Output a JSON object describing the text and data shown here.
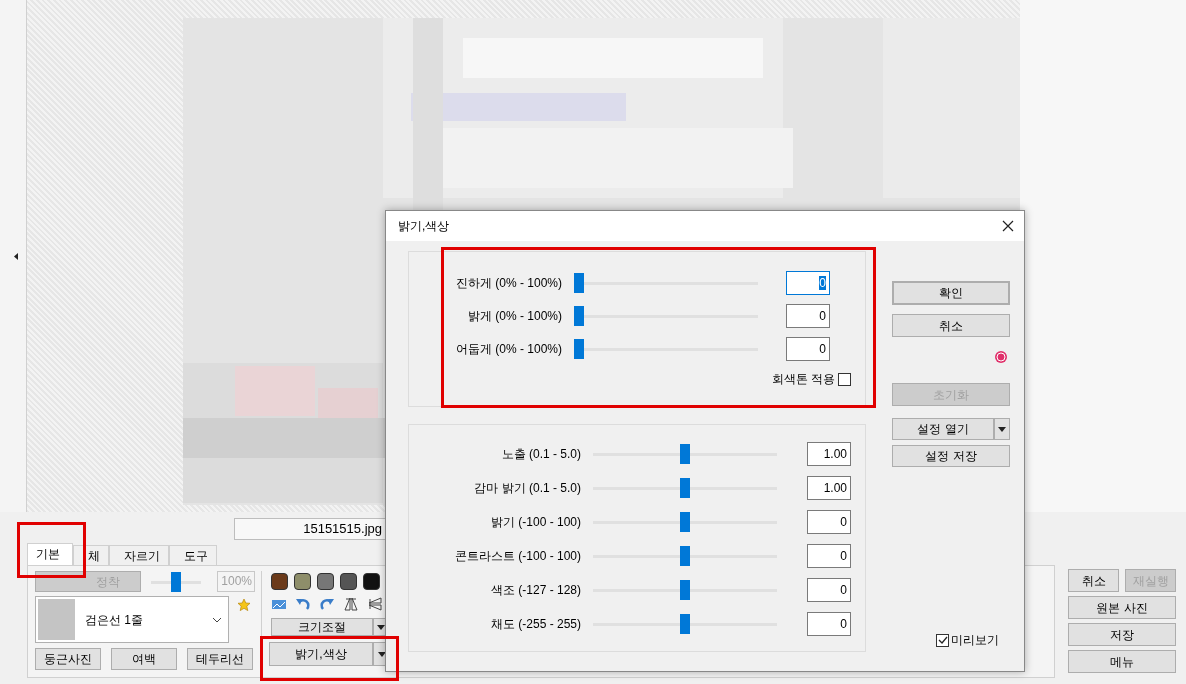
{
  "filename": "15151515.jpg",
  "tabs": [
    {
      "label": "기본",
      "selected": true
    },
    {
      "label": "체",
      "selected": false
    },
    {
      "label": "자르기",
      "selected": false
    },
    {
      "label": "도구",
      "selected": false
    }
  ],
  "panel": {
    "fix_button": {
      "label": "정착",
      "disabled": true
    },
    "opacity": {
      "level": 0.5,
      "value": "100%"
    },
    "frame_select": {
      "value": "검은선 1줄"
    },
    "bottom_buttons": [
      "둥근사진",
      "여백",
      "테두리선"
    ],
    "swatches": [
      {
        "color": "#6b3a1a"
      },
      {
        "color": "#8e8e6a"
      },
      {
        "color": "#777777"
      },
      {
        "color": "#555555"
      },
      {
        "color": "#111111"
      }
    ],
    "resize_button": "크기조절",
    "color_button": "밝기,색상"
  },
  "side_buttons": [
    {
      "label": "취소",
      "disabled": false
    },
    {
      "label": "재실행",
      "disabled": true
    },
    {
      "label": "원본 사진",
      "disabled": false
    },
    {
      "label": "저장",
      "disabled": false
    },
    {
      "label": "메뉴",
      "disabled": false
    }
  ],
  "dialog": {
    "title": "밝기,색상",
    "group_1": [
      {
        "label": "진하게 (0% - 100%)",
        "level": 0,
        "value": "0",
        "focused": true
      },
      {
        "label": "밝게 (0% - 100%)",
        "level": 0,
        "value": "0",
        "focused": false
      },
      {
        "label": "어둡게 (0% - 100%)",
        "level": 0,
        "value": "0",
        "focused": false
      }
    ],
    "grayscale": {
      "label": "회색톤 적용",
      "checked": false
    },
    "group_2": [
      {
        "label": "노출 (0.1 - 5.0)",
        "level": 0.5,
        "value": "1.00"
      },
      {
        "label": "감마 밝기 (0.1 - 5.0)",
        "level": 0.5,
        "value": "1.00"
      },
      {
        "label": "밝기 (-100 - 100)",
        "level": 0.5,
        "value": "0"
      },
      {
        "label": "콘트라스트 (-100 - 100)",
        "level": 0.5,
        "value": "0"
      },
      {
        "label": "색조 (-127 - 128)",
        "level": 0.5,
        "value": "0"
      },
      {
        "label": "채도 (-255 - 255)",
        "level": 0.5,
        "value": "0"
      }
    ],
    "ok_button": "확인",
    "cancel_button": "취소",
    "reset_button": {
      "label": "초기화",
      "disabled": true
    },
    "load_button": "설정 열기",
    "save_button": "설정 저장",
    "preview": {
      "label": "미리보기",
      "checked": true
    }
  }
}
